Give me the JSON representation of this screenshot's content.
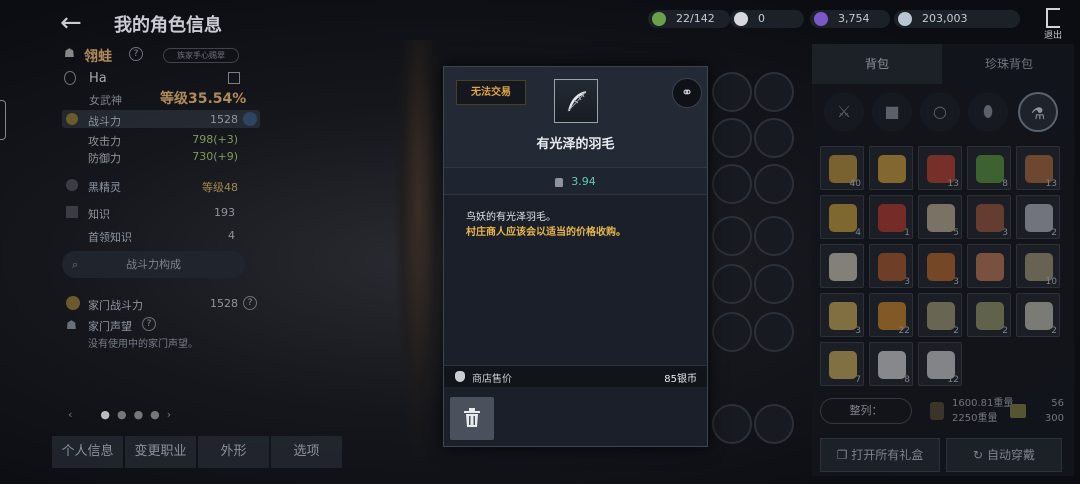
{
  "header": {
    "title": "我的角色信息"
  },
  "character": {
    "family_name": "翎蛙",
    "pill_text": "族家手心赐翠",
    "name": "Ha",
    "class": "女武神",
    "level": "等级35.54%",
    "stats": [
      {
        "label": "战斗力",
        "value": "1528"
      },
      {
        "label": "攻击力",
        "value": "798(+3)"
      },
      {
        "label": "防御力",
        "value": "730(+9)"
      },
      {
        "label": "黑精灵",
        "value": "等级48"
      },
      {
        "label": "知识",
        "value": "193"
      },
      {
        "label": "首领知识",
        "value": "4"
      }
    ],
    "combat_button": "战斗力构成",
    "family_power_label": "家门战斗力",
    "family_power_value": "1528",
    "family_fame_label": "家门声望",
    "no_fame_text": "没有使用中的家门声望。"
  },
  "left_tabs": [
    "个人信息",
    "变更职业",
    "外形",
    "选项"
  ],
  "resources": [
    {
      "name": "energy",
      "value": "22/142",
      "color": "#6aa04a"
    },
    {
      "name": "pearl",
      "value": "0",
      "color": "#d7d7e0"
    },
    {
      "name": "crystal",
      "value": "3,754",
      "color": "#7a58c8"
    },
    {
      "name": "silver",
      "value": "203,003",
      "color": "#b7c6d2"
    }
  ],
  "exit_label": "退出",
  "inventory": {
    "tabs": [
      "背包",
      "珍珠背包"
    ],
    "filters": [
      "swords-icon",
      "armor-icon",
      "ring-icon",
      "gem-icon",
      "flask-icon"
    ],
    "items": [
      {
        "count": "40",
        "color": "#c79a3a"
      },
      {
        "count": "",
        "color": "#d8a43b"
      },
      {
        "count": "13",
        "color": "#c2402e"
      },
      {
        "count": "8",
        "color": "#5a9b3a"
      },
      {
        "count": "13",
        "color": "#b06a3a"
      },
      {
        "count": "4",
        "color": "#d1a53a"
      },
      {
        "count": "1",
        "color": "#c0392b"
      },
      {
        "count": "5",
        "color": "#c8b89a"
      },
      {
        "count": "3",
        "color": "#a0583a"
      },
      {
        "count": "2",
        "color": "#b8bcc4"
      },
      {
        "count": "",
        "color": "#d8d0c0"
      },
      {
        "count": "3",
        "color": "#b55a2a"
      },
      {
        "count": "3",
        "color": "#c06a2a"
      },
      {
        "count": "",
        "color": "#c87a5a"
      },
      {
        "count": "10",
        "color": "#a89a7a"
      },
      {
        "count": "3",
        "color": "#d6b35a"
      },
      {
        "count": "22",
        "color": "#d68a2a"
      },
      {
        "count": "2",
        "color": "#a8a07a"
      },
      {
        "count": "2",
        "color": "#9a9a6a"
      },
      {
        "count": "2",
        "color": "#c8c8b8"
      },
      {
        "count": "7",
        "color": "#d6b45a"
      },
      {
        "count": "8",
        "color": "#e0e0e0"
      },
      {
        "count": "12",
        "color": "#d8d8d8"
      }
    ],
    "sort_label": "整列：",
    "weight_current": "1600.81重量",
    "weight_max": "2250重量",
    "slots_used": "56",
    "slots_max": "300",
    "open_all_label": "打开所有礼盒",
    "auto_equip_label": "自动穿戴"
  },
  "popup": {
    "untradable": "无法交易",
    "item_name": "有光泽的羽毛",
    "weight": "3.94",
    "description_line1": "鸟妖的有光泽羽毛。",
    "description_line2": "村庄商人应该会以适当的价格收购。",
    "price_label": "商店售价",
    "price_value": "85银币"
  }
}
